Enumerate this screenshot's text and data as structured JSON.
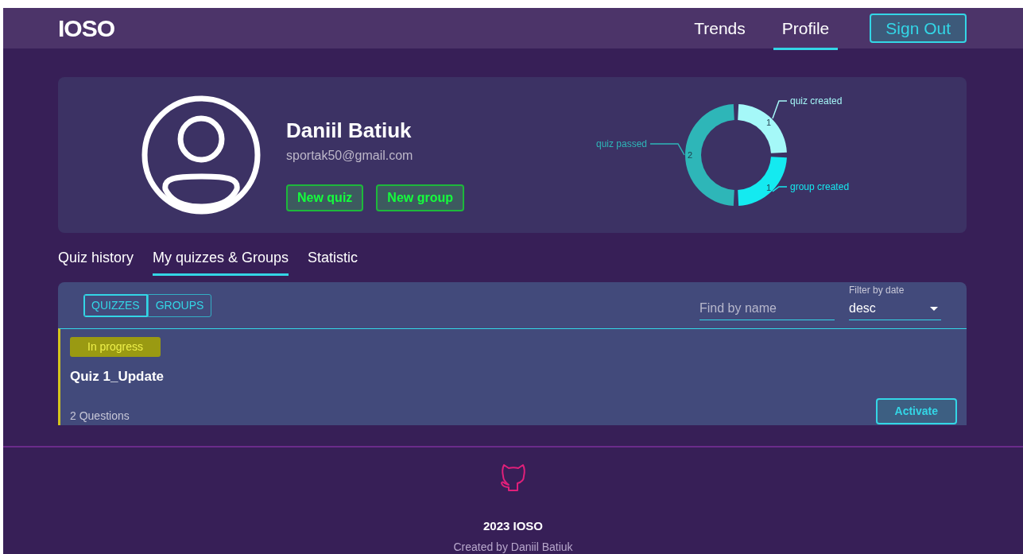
{
  "navbar": {
    "brand": "IOSO",
    "links": [
      {
        "label": "Trends",
        "selected": false
      },
      {
        "label": "Profile",
        "selected": true
      }
    ],
    "sign_out": "Sign Out"
  },
  "profile": {
    "name": "Daniil Batiuk",
    "email": "sportak50@gmail.com",
    "buttons": [
      "New quiz",
      "New group"
    ],
    "chart_data": {
      "type": "donut",
      "categories": [
        "quiz created",
        "group created",
        "quiz passed"
      ],
      "values": [
        1,
        1,
        2
      ],
      "value_labels": [
        "1",
        "1",
        "2"
      ]
    }
  },
  "tabs": [
    {
      "label": "Quiz history",
      "selected": false
    },
    {
      "label": "My quizzes & Groups",
      "selected": true
    },
    {
      "label": "Statistic",
      "selected": false
    }
  ],
  "toggle": [
    {
      "label": "QUIZZES",
      "selected": true
    },
    {
      "label": "GROUPS",
      "selected": false
    }
  ],
  "search": {
    "placeholder": "Find by name"
  },
  "filter": {
    "label": "Filter by date",
    "value": "desc"
  },
  "quizzes": [
    {
      "status": "In progress",
      "title": "Quiz 1_Update",
      "questions": "2 Questions",
      "action": "Activate"
    }
  ],
  "footer": {
    "year": "2023 IOSO",
    "credit": "Created by Daniil Batiuk"
  }
}
